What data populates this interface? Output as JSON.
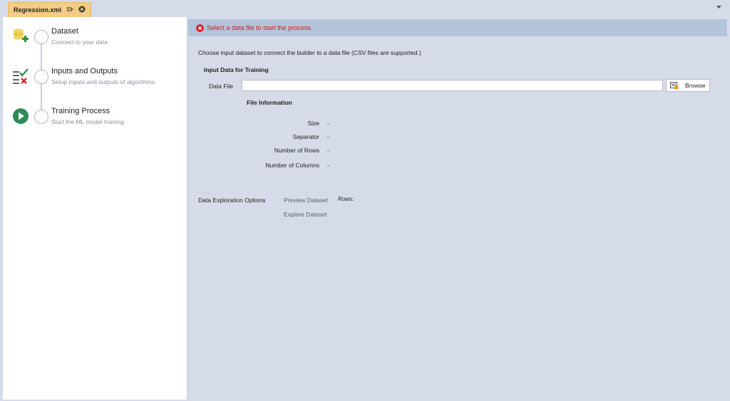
{
  "tab": {
    "title": "Regression.xml"
  },
  "steps": [
    {
      "title": "Dataset",
      "subtitle": "Connect to your data",
      "icon": "database-add-icon"
    },
    {
      "title": "Inputs and Outputs",
      "subtitle": "Setup inputs and outputs of algorithms",
      "icon": "inputs-outputs-icon"
    },
    {
      "title": "Training Process",
      "subtitle": "Start the ML model training",
      "icon": "play-icon"
    }
  ],
  "error": {
    "message": "Select a data file to start the process.",
    "color": "#d8141d"
  },
  "main": {
    "intro": "Choose input dataset to connect the builder to a data file (CSV files are supported.)",
    "section_heading": "Input Data for Training",
    "data_file_label": "Data File",
    "data_file_value": "",
    "browse_label": "Browse",
    "file_info_heading": "File Information",
    "file_info": [
      {
        "label": "Size",
        "value": "-"
      },
      {
        "label": "Separator",
        "value": "-"
      },
      {
        "label": "Number of Rows",
        "value": "-"
      },
      {
        "label": "Number of Columns",
        "value": "-"
      }
    ],
    "exploration_label": "Data Exploration Options",
    "preview_link": "Preview Dataset",
    "rows_label": "Rows:",
    "explore_link": "Explore Dataset"
  },
  "colors": {
    "tab_active": "#f5cc84",
    "panel_bg": "#d6dbe9",
    "error_bar_bg": "#b4c4db",
    "play_green": "#2e8b57"
  }
}
